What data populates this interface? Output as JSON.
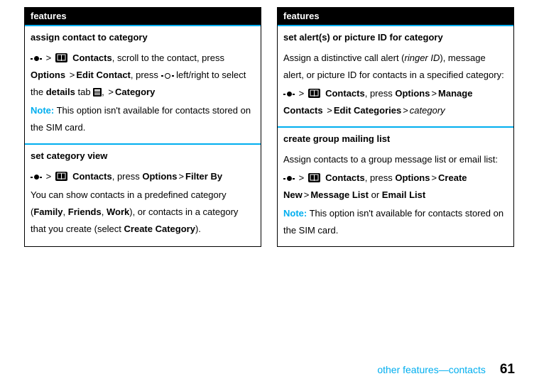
{
  "left": {
    "header": "features",
    "f1": {
      "title": "assign contact to category",
      "contacts": "Contacts",
      "t1": ", scroll to the contact, press ",
      "options": "Options",
      "t2": "Edit Contact",
      "t3": ", press ",
      "t4": " left/right to select the ",
      "details": "details",
      "t5": " tab ",
      "t6": ", ",
      "t7": "Category",
      "noteLabel": "Note:",
      "note": " This option isn't available for contacts stored on the SIM card."
    },
    "f2": {
      "title": "set category view",
      "contacts": "Contacts",
      "t1": ", press ",
      "options": "Options",
      "filter": "Filter By",
      "p2a": "You can show contacts in a predefined category (",
      "family": "Family",
      "c1": ", ",
      "friends": "Friends",
      "c2": ", ",
      "work": "Work",
      "p2b": "), or contacts in a category that you create (select ",
      "create": "Create Category",
      "p2c": ")."
    }
  },
  "right": {
    "header": "features",
    "f1": {
      "title": "set alert(s) or picture ID for category",
      "p1a": "Assign a distinctive call alert (",
      "ringer": "ringer ID",
      "p1b": "), message alert, or picture ID for contacts in a specified category:",
      "contacts": "Contacts",
      "t1": ", press ",
      "options": "Options",
      "manage": "Manage Contacts",
      "edit": "Edit Categories",
      "cat": "category"
    },
    "f2": {
      "title": "create group mailing list",
      "p1": "Assign contacts to a group message list or email list:",
      "contacts": "Contacts",
      "t1": ", press ",
      "options": "Options",
      "create": "Create New",
      "msg": "Message List",
      "or": " or ",
      "email": "Email List",
      "noteLabel": "Note:",
      "note": " This option isn't available for contacts stored on the SIM card."
    }
  },
  "footer": {
    "section": "other features—contacts",
    "page": "61"
  },
  "gt": ">"
}
